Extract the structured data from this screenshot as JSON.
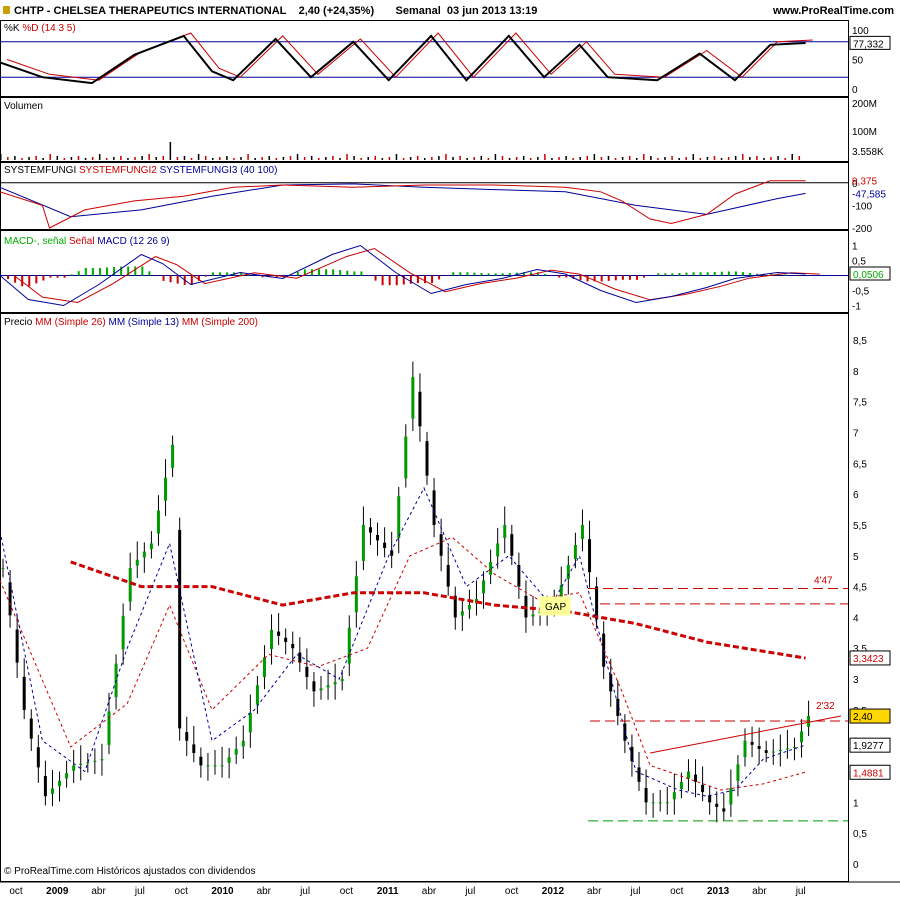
{
  "header": {
    "title": "CHTP - CHELSEA THERAPEUTICS INTERNATIONAL",
    "price": "2,40 (+24,35%)",
    "period": "Semanal",
    "datetime": "03 jun 2013 13:19",
    "site": "www.ProRealTime.com"
  },
  "copyright": "© ProRealTime.com  Históricos ajustados con dividendos",
  "colors": {
    "accent_red": "#cc0000",
    "accent_blue": "#000099",
    "macd_green": "#00aa00",
    "price_tag": "#ffd700"
  },
  "chart_data": [
    {
      "type": "line",
      "panel": "stochastic",
      "legend": [
        "%K",
        "%D (14 3 5)"
      ],
      "y_ticks": [
        "100",
        "50",
        "0"
      ],
      "levels": [
        80,
        20
      ],
      "last_value": "77,332",
      "k_points": [
        [
          0,
          45
        ],
        [
          6,
          20
        ],
        [
          13,
          10
        ],
        [
          19,
          58
        ],
        [
          26,
          90
        ],
        [
          30,
          30
        ],
        [
          33,
          15
        ],
        [
          39,
          85
        ],
        [
          44,
          20
        ],
        [
          50,
          80
        ],
        [
          55,
          15
        ],
        [
          61,
          90
        ],
        [
          66,
          15
        ],
        [
          72,
          90
        ],
        [
          77,
          20
        ],
        [
          82,
          75
        ],
        [
          86,
          20
        ],
        [
          93,
          15
        ],
        [
          99,
          60
        ],
        [
          104,
          15
        ],
        [
          109,
          75
        ],
        [
          114,
          78
        ]
      ]
    },
    {
      "type": "bar",
      "panel": "volume",
      "label": "Volumen",
      "y_ticks": [
        "200M",
        "100M"
      ],
      "last_value": "3.558K"
    },
    {
      "type": "line",
      "panel": "systemfungi",
      "legend": [
        "SYSTEMFUNGI",
        "SYSTEMFUNGI2",
        "SYSTEMFUNGI3 (40 100)"
      ],
      "y_ticks": [
        "0",
        "-100",
        "-200"
      ],
      "values": [
        "9,375",
        "-47,585"
      ],
      "red_points": [
        [
          0,
          -40
        ],
        [
          6,
          -100
        ],
        [
          7,
          -200
        ],
        [
          12,
          -120
        ],
        [
          19,
          -80
        ],
        [
          26,
          -60
        ],
        [
          33,
          -20
        ],
        [
          40,
          -10
        ],
        [
          50,
          -20
        ],
        [
          60,
          -10
        ],
        [
          70,
          -10
        ],
        [
          80,
          -20
        ],
        [
          85,
          -40
        ],
        [
          88,
          -80
        ],
        [
          92,
          -160
        ],
        [
          95,
          -180
        ],
        [
          100,
          -140
        ],
        [
          104,
          -50
        ],
        [
          109,
          9
        ],
        [
          114,
          9
        ]
      ],
      "blue_points": [
        [
          0,
          -20
        ],
        [
          10,
          -150
        ],
        [
          20,
          -120
        ],
        [
          30,
          -60
        ],
        [
          40,
          -10
        ],
        [
          50,
          -5
        ],
        [
          60,
          -20
        ],
        [
          70,
          -30
        ],
        [
          80,
          -40
        ],
        [
          90,
          -100
        ],
        [
          100,
          -140
        ],
        [
          110,
          -70
        ],
        [
          114,
          -47
        ]
      ]
    },
    {
      "type": "line",
      "panel": "macd",
      "legend": [
        "MACD-, señal",
        "Señal",
        "MACD (12 26 9)"
      ],
      "y_ticks": [
        "1",
        "0,5",
        "-0,5",
        "-1"
      ],
      "last_value": "0,0506",
      "macd_points": [
        [
          0,
          0
        ],
        [
          4,
          -0.8
        ],
        [
          9,
          -1.0
        ],
        [
          14,
          -0.3
        ],
        [
          20,
          0.7
        ],
        [
          23,
          0.4
        ],
        [
          27,
          -0.3
        ],
        [
          34,
          0.1
        ],
        [
          40,
          -0.1
        ],
        [
          47,
          0.7
        ],
        [
          51,
          1.0
        ],
        [
          56,
          0.1
        ],
        [
          61,
          -0.6
        ],
        [
          66,
          -0.3
        ],
        [
          71,
          -0.1
        ],
        [
          76,
          0.2
        ],
        [
          80,
          0.05
        ],
        [
          85,
          -0.5
        ],
        [
          90,
          -0.9
        ],
        [
          95,
          -0.7
        ],
        [
          100,
          -0.4
        ],
        [
          104,
          -0.1
        ],
        [
          110,
          0.1
        ],
        [
          114,
          0.05
        ]
      ]
    },
    {
      "type": "line",
      "panel": "price",
      "legend": [
        "Precio",
        "MM (Simple 26)",
        "MM (Simple 13)",
        "MM (Simple 200)"
      ],
      "y_ticks": [
        "8,5",
        "8",
        "7,5",
        "7",
        "6,5",
        "6",
        "5,5",
        "5",
        "4,5",
        "4",
        "3,5",
        "3",
        "2,5",
        "2",
        "1,5",
        "1",
        "0,5",
        "0"
      ],
      "ylim": [
        0,
        8.5
      ],
      "x_ticks": [
        "oct",
        "2009",
        "abr",
        "jul",
        "oct",
        "2010",
        "abr",
        "jul",
        "oct",
        "2011",
        "abr",
        "jul",
        "oct",
        "2012",
        "abr",
        "jul",
        "oct",
        "2013",
        "abr",
        "jul"
      ],
      "price_labels": [
        "2,40",
        "1,9277",
        "1,4881",
        "3,3423"
      ],
      "annotations": [
        "4'47",
        "2'32",
        "GAP"
      ],
      "price_points": [
        [
          0,
          4.8
        ],
        [
          3,
          2.5
        ],
        [
          6,
          1.1
        ],
        [
          10,
          1.6
        ],
        [
          14,
          1.7
        ],
        [
          18,
          4.8
        ],
        [
          21,
          5.2
        ],
        [
          24,
          6.8
        ],
        [
          25,
          2.2
        ],
        [
          28,
          1.6
        ],
        [
          31,
          1.6
        ],
        [
          34,
          2.0
        ],
        [
          38,
          3.8
        ],
        [
          41,
          3.5
        ],
        [
          44,
          2.8
        ],
        [
          48,
          3.0
        ],
        [
          51,
          5.5
        ],
        [
          55,
          5.0
        ],
        [
          58,
          7.9
        ],
        [
          61,
          5.5
        ],
        [
          64,
          4.0
        ],
        [
          67,
          4.3
        ],
        [
          71,
          5.5
        ],
        [
          74,
          4.0
        ],
        [
          78,
          4.2
        ],
        [
          82,
          5.5
        ],
        [
          85,
          3.2
        ],
        [
          88,
          2.0
        ],
        [
          91,
          1.0
        ],
        [
          94,
          1.0
        ],
        [
          97,
          1.5
        ],
        [
          100,
          1.0
        ],
        [
          102,
          0.85
        ],
        [
          105,
          2.0
        ],
        [
          108,
          1.8
        ],
        [
          112,
          1.9
        ],
        [
          114,
          2.4
        ]
      ],
      "sma200_points": [
        [
          10,
          4.9
        ],
        [
          20,
          4.5
        ],
        [
          30,
          4.5
        ],
        [
          40,
          4.2
        ],
        [
          50,
          4.4
        ],
        [
          60,
          4.4
        ],
        [
          70,
          4.2
        ],
        [
          80,
          4.1
        ],
        [
          90,
          3.9
        ],
        [
          100,
          3.6
        ],
        [
          114,
          3.34
        ]
      ],
      "sma26_points": [
        [
          0,
          4.6
        ],
        [
          10,
          1.9
        ],
        [
          18,
          2.6
        ],
        [
          24,
          4.2
        ],
        [
          30,
          2.5
        ],
        [
          38,
          3.4
        ],
        [
          45,
          3.2
        ],
        [
          52,
          3.5
        ],
        [
          58,
          5.0
        ],
        [
          64,
          5.3
        ],
        [
          70,
          4.7
        ],
        [
          76,
          4.3
        ],
        [
          82,
          4.4
        ],
        [
          88,
          2.8
        ],
        [
          92,
          1.6
        ],
        [
          97,
          1.4
        ],
        [
          102,
          1.2
        ],
        [
          108,
          1.3
        ],
        [
          114,
          1.49
        ]
      ],
      "sma13_points": [
        [
          0,
          5.4
        ],
        [
          6,
          2.0
        ],
        [
          12,
          1.5
        ],
        [
          18,
          3.5
        ],
        [
          24,
          5.2
        ],
        [
          30,
          2.0
        ],
        [
          36,
          2.5
        ],
        [
          42,
          3.4
        ],
        [
          48,
          3.0
        ],
        [
          55,
          5.0
        ],
        [
          60,
          6.1
        ],
        [
          66,
          4.5
        ],
        [
          72,
          5.0
        ],
        [
          78,
          4.2
        ],
        [
          82,
          5.0
        ],
        [
          86,
          3.2
        ],
        [
          90,
          1.5
        ],
        [
          96,
          1.2
        ],
        [
          100,
          1.1
        ],
        [
          104,
          1.2
        ],
        [
          108,
          1.7
        ],
        [
          114,
          1.93
        ]
      ],
      "horizontal_levels": [
        4.47,
        4.22,
        2.32,
        0.7
      ],
      "trendline": [
        [
          92,
          1.8
        ],
        [
          119,
          2.4
        ]
      ]
    }
  ]
}
